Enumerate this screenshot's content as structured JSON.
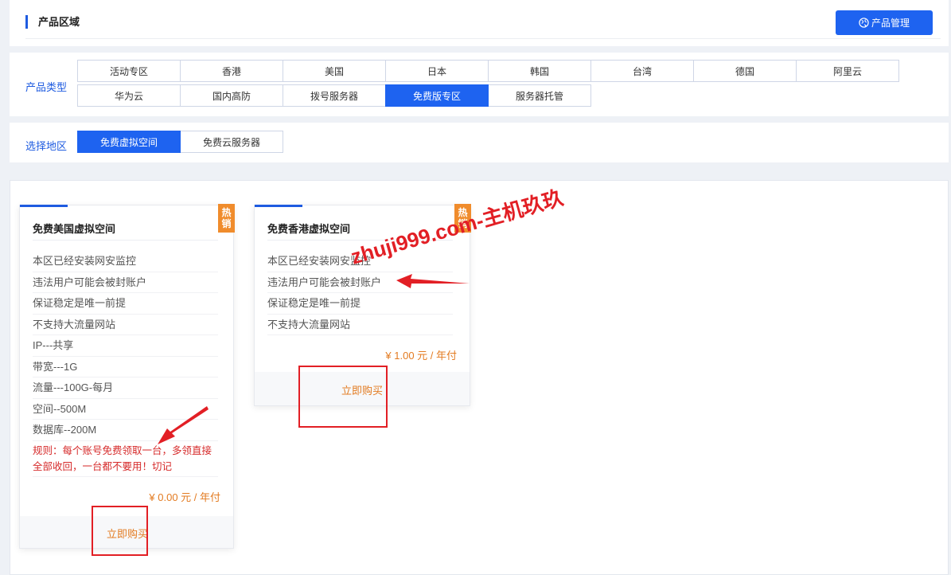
{
  "header": {
    "section_title": "产品区域",
    "manage_button": "产品管理",
    "manage_icon": "globe-icon"
  },
  "product_types": {
    "label": "产品类型",
    "row1": [
      "活动专区",
      "香港",
      "美国",
      "日本",
      "韩国",
      "台湾",
      "德国",
      "阿里云"
    ],
    "row2": [
      "华为云",
      "国内高防",
      "拨号服务器",
      "免费版专区",
      "服务器托管"
    ],
    "active": "免费版专区"
  },
  "region": {
    "label": "选择地区",
    "tabs": [
      "免费虚拟空间",
      "免费云服务器"
    ],
    "active": "免费虚拟空间"
  },
  "products": [
    {
      "title": "免费美国虚拟空间",
      "badge": "热销",
      "features": [
        "本区已经安装网安监控",
        "违法用户可能会被封账户",
        "保证稳定是唯一前提",
        "不支持大流量网站",
        "IP---共享",
        "带宽---1G",
        "流量---100G-每月",
        "空间--500M",
        "数据库--200M"
      ],
      "rule": "规则：每个账号免费领取一台，多领直接全部收回，一台都不要用！切记",
      "price": "¥ 0.00 元 / 年付",
      "buy": "立即购买"
    },
    {
      "title": "免费香港虚拟空间",
      "badge": "热销",
      "features": [
        "本区已经安装网安监控",
        "违法用户可能会被封账户",
        "保证稳定是唯一前提",
        "不支持大流量网站"
      ],
      "price": "¥ 1.00 元 / 年付",
      "buy": "立即购买"
    }
  ],
  "watermark": "zhuji999.com-主机玖玖",
  "colors": {
    "accent": "#1e63f0",
    "price": "#e37b21",
    "badge": "#f08c2c",
    "rule": "#d62b2b",
    "annotation": "#e21f25"
  }
}
